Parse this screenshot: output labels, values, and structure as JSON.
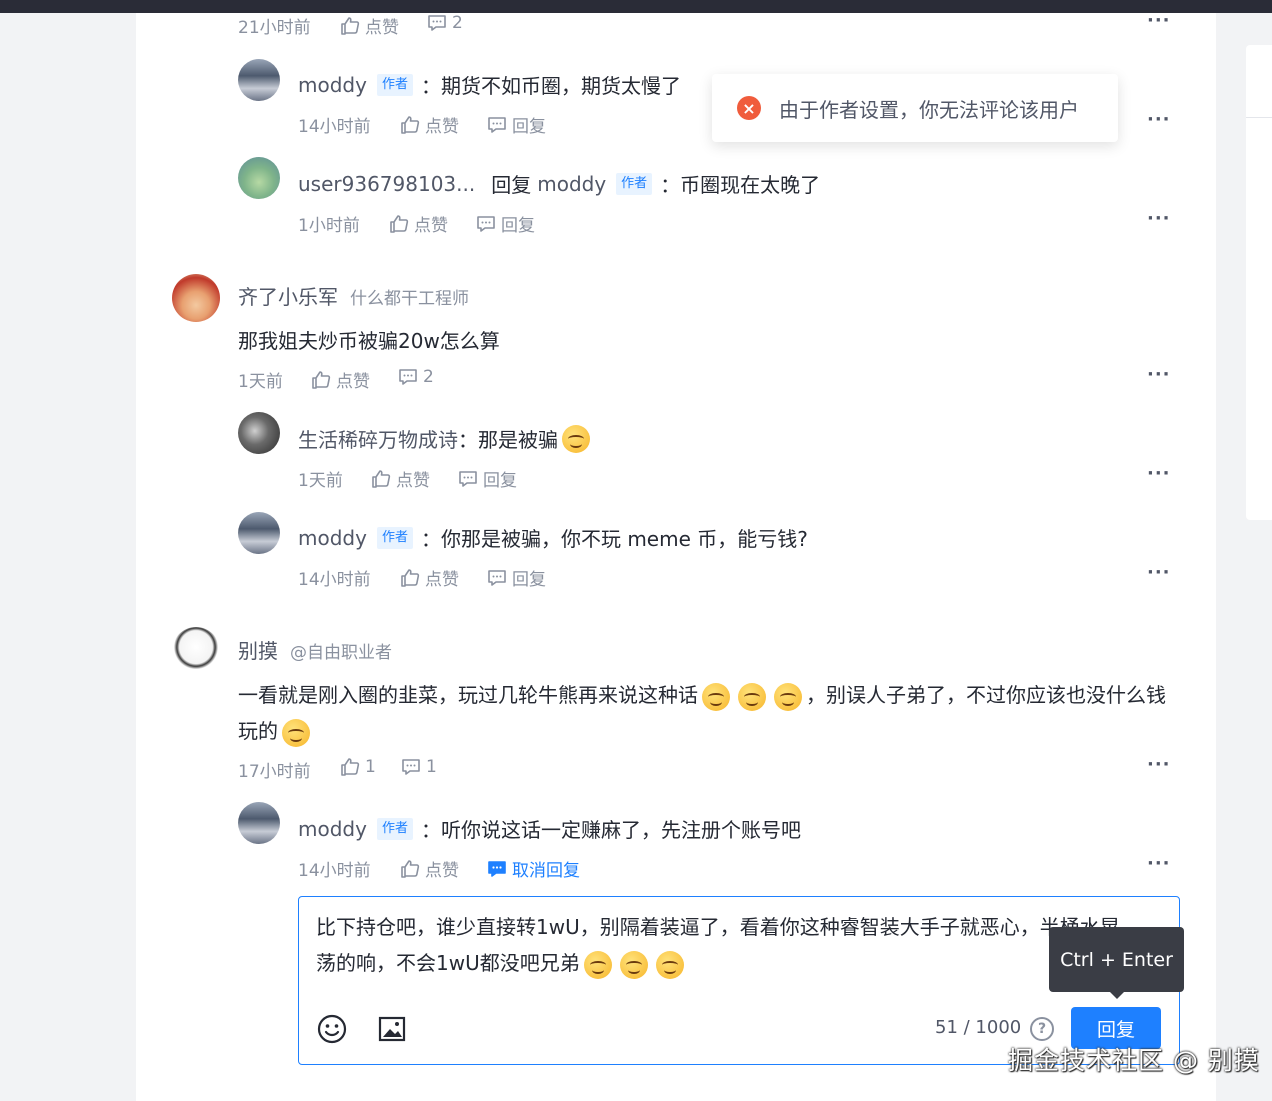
{
  "messages": {
    "like": "点赞",
    "reply": "回复",
    "author": "作者",
    "reply_to": "回复",
    "more": "···"
  },
  "toast": {
    "text": "由于作者设置，你无法评论该用户"
  },
  "top_row": {
    "time": "21小时前",
    "comment_count": "2"
  },
  "thread1_replies": [
    {
      "user": "moddy",
      "text": "：期货不如币圈，期货太慢了",
      "time": "14小时前"
    },
    {
      "user": "user936798103...",
      "reply_to_user": "moddy",
      "text": "：币圈现在太晚了",
      "time": "1小时前"
    }
  ],
  "comment2": {
    "user": "齐了小乐军",
    "title": "什么都干工程师",
    "text": "那我姐夫炒币被骗20w怎么算",
    "time": "1天前",
    "comment_count": "2",
    "replies": [
      {
        "user": "生活稀碎万物成诗",
        "text": "：那是被骗",
        "time": "1天前"
      },
      {
        "user": "moddy",
        "text": "：你那是被骗，你不玩 meme 币，能亏钱?",
        "time": "14小时前"
      }
    ]
  },
  "comment3": {
    "user": "别摸",
    "title": "@自由职业者",
    "text_a": "一看就是刚入圈的韭菜，玩过几轮牛熊再来说这种话",
    "text_b": "，别误人子弟了，不过你应该也没什",
    "text_c": "么钱玩的",
    "time": "17小时前",
    "like_count": "1",
    "comment_count": "1",
    "reply": {
      "user": "moddy",
      "text": "：听你说这话一定赚麻了，先注册个账号吧",
      "time": "14小时前",
      "cancel": "取消回复"
    }
  },
  "editor": {
    "line1": "比下持仓吧，谁少直接转1wU，别隔着装逼了，看着你这种睿智装大手子就恶心，半桶水晃",
    "line2": "荡的响，不会1wU都没吧兄弟",
    "counter": "51 / 1000",
    "help": "?",
    "submit": "回复",
    "tooltip": "Ctrl + Enter"
  },
  "watermark": "掘金技术社区 @ 别摸",
  "colors": {
    "accent": "#1e80ff",
    "error": "#f05c3c",
    "text": "#252933",
    "muted": "#8a919f"
  }
}
